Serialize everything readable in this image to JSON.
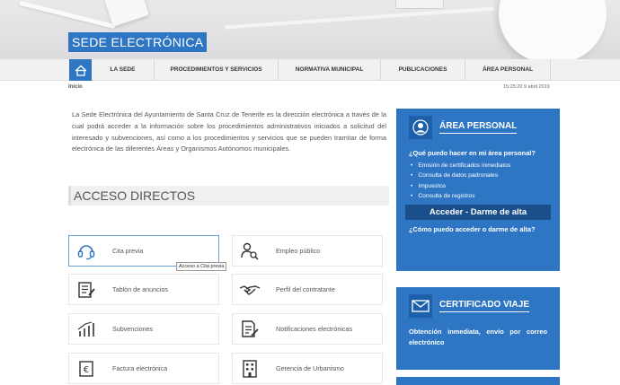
{
  "site": {
    "brand": "SEDE ELECTRÓNICA"
  },
  "nav": {
    "items": [
      {
        "label": "LA SEDE"
      },
      {
        "label": "PROCEDIMIENTOS Y SERVICIOS"
      },
      {
        "label": "NORMATIVA MUNICIPAL"
      },
      {
        "label": "PUBLICACIONES"
      },
      {
        "label": "ÁREA PERSONAL"
      }
    ]
  },
  "breadcrumb": {
    "current": "Inicio"
  },
  "timestamp": "15:25:20 9 abril 2019",
  "intro": "La Sede Electrónica del Ayuntamiento de Santa Cruz de Tenerife es la dirección electrónica a través de la cual podrá acceder a la información sobre los procedimientos administrativos iniciados a solicitud del interesado y subvenciones, así como a los procedimientos y servicios que se pueden tramitar de forma electrónica de las diferentes Áreas y Organismos Autónomos municipales.",
  "access": {
    "title": "ACCESO DIRECTOS",
    "items": [
      {
        "label": "Cita previa",
        "icon": "headset-icon"
      },
      {
        "label": "Empleo público",
        "icon": "job-search-icon"
      },
      {
        "label": "Tablón de anuncios",
        "icon": "notice-board-icon"
      },
      {
        "label": "Perfil del contratante",
        "icon": "handshake-icon"
      },
      {
        "label": "Subvenciones",
        "icon": "bar-chart-icon"
      },
      {
        "label": "Notificaciones electrónicas",
        "icon": "document-edit-icon"
      },
      {
        "label": "Factura electrónica",
        "icon": "euro-icon"
      },
      {
        "label": "Gerencia de Urbanismo",
        "icon": "building-icon"
      }
    ],
    "tooltip": "Acceso a Cita previa"
  },
  "area_personal": {
    "title": "ÁREA PERSONAL",
    "question1": "¿Qué puedo hacer en mi área personal?",
    "bullets": [
      "Emisión de certificados inmediatos",
      "Consulta de datos padronales",
      "Impuestos",
      "Consulta de registros"
    ],
    "cta": "Acceder - Darme de alta",
    "question2": "¿Cómo puedo acceder o darme de alta?"
  },
  "certificado": {
    "title": "CERTIFICADO VIAJE",
    "text": "Obtención inmediata, envío por correo electrónico"
  },
  "colors": {
    "accent": "#2e75c4",
    "cta": "#1b4f8c"
  }
}
